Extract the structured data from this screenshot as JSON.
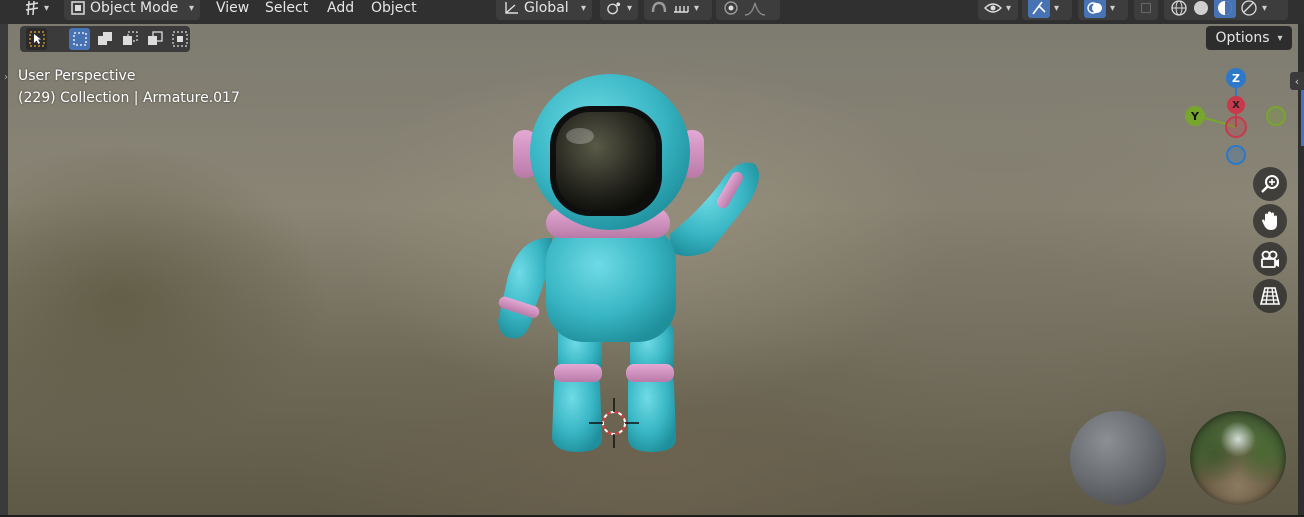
{
  "header": {
    "mode_label": "Object Mode",
    "menus": [
      "View",
      "Select",
      "Add",
      "Object"
    ],
    "orientation_label": "Global"
  },
  "toolbar": {
    "options_label": "Options"
  },
  "overlay_info": {
    "view_name": "User Perspective",
    "collection": "(229) Collection",
    "separator": "|",
    "object_name": "Armature.017"
  },
  "gizmo": {
    "z_label": "Z",
    "y_label": "Y",
    "x_label": "X",
    "colors": {
      "x": "#c9394b",
      "y": "#78a62c",
      "z": "#2d78c9"
    }
  },
  "icons": {
    "nav": [
      "zoom-icon",
      "hand-pan-icon",
      "camera-icon",
      "grid-perspective-icon"
    ]
  },
  "colors": {
    "header_bg": "#303030",
    "accent": "#4772b3",
    "suit": "#39b6c4",
    "trim": "#d79ac6"
  }
}
